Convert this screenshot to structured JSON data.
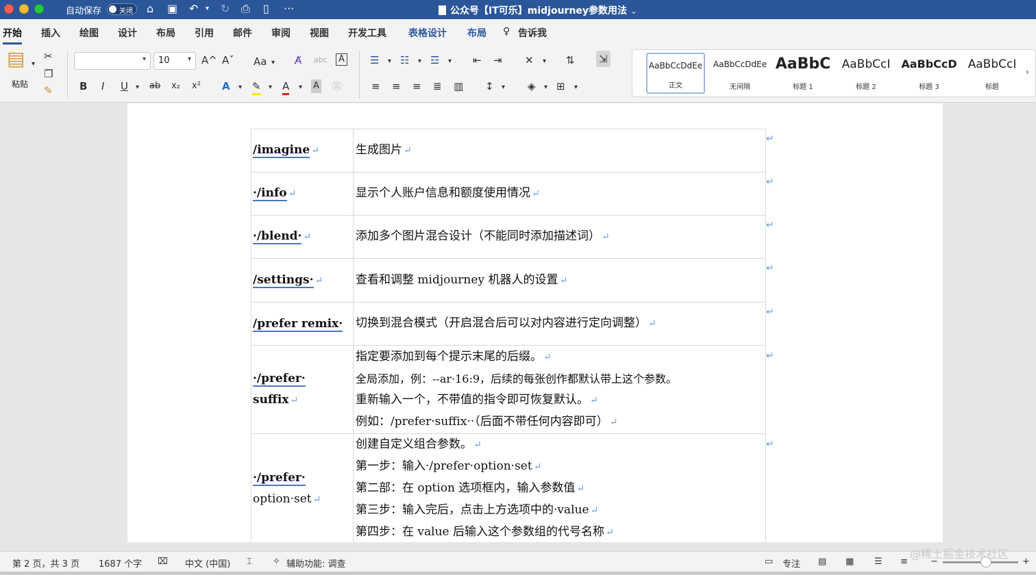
{
  "titlebar": {
    "autosave_label": "自动保存",
    "autosave_state": "关闭",
    "document_title": "公众号【IT可乐】midjourney参数用法",
    "title_chevron": "⌄"
  },
  "tabs": [
    "开始",
    "插入",
    "绘图",
    "设计",
    "布局",
    "引用",
    "邮件",
    "审阅",
    "视图",
    "开发工具",
    "表格设计",
    "布局",
    "告诉我"
  ],
  "ribbon": {
    "paste_label": "粘贴",
    "font_name": "",
    "font_size": "10",
    "grow_font": "A^",
    "shrink_font": "Aˇ",
    "change_case": "Aa",
    "bold": "B",
    "italic": "I",
    "underline": "U",
    "strikethrough": "ab",
    "subscript": "x₂",
    "superscript": "x²",
    "styles": [
      {
        "sample": "AaBbCcDdEe",
        "name": "正文"
      },
      {
        "sample": "AaBbCcDdEe",
        "name": "无间隔"
      },
      {
        "sample": "AaBbC",
        "name": "标题 1"
      },
      {
        "sample": "AaBbCcI",
        "name": "标题 2"
      },
      {
        "sample": "AaBbCcD",
        "name": "标题 3"
      },
      {
        "sample": "AaBbCcI",
        "name": "标题"
      }
    ]
  },
  "table": {
    "rows": [
      {
        "cmd": "/imagine",
        "lines": [
          "生成图片"
        ]
      },
      {
        "cmd": "·/info",
        "lines": [
          "显示个人账户信息和额度使用情况"
        ]
      },
      {
        "cmd": "·/blend·",
        "lines": [
          "添加多个图片混合设计（不能同时添加描述词）"
        ]
      },
      {
        "cmd": "/settings·",
        "lines": [
          "查看和调整 midjourney 机器人的设置"
        ]
      },
      {
        "cmd": "/prefer remix·",
        "lines": [
          "切换到混合模式（开启混合后可以对内容进行定向调整）"
        ]
      },
      {
        "cmd_lines": [
          "·/prefer·",
          "suffix"
        ],
        "lines": [
          "指定要添加到每个提示末尾的后缀。",
          "全局添加，例：--ar·16:9，后续的每张创作都默认带上这个参数。",
          "重新输入一个，不带值的指令即可恢复默认。",
          "例如：/prefer·suffix··（后面不带任何内容即可）"
        ]
      },
      {
        "cmd_lines": [
          "·/prefer·",
          "option·set"
        ],
        "lines": [
          "创建自定义组合参数。",
          "第一步：输入·/prefer·option·set",
          "第二部：在 option 选项框内，输入参数值",
          "第三步：输入完后，点击上方选项中的·value",
          "第四步：在 value 后输入这个参数组的代号名称"
        ]
      }
    ],
    "paragraph_mark": "↵"
  },
  "status": {
    "page": "第 2 页，共 3 页",
    "words": "1687 个字",
    "language": "中文 (中国)",
    "accessibility": "辅助功能: 调查",
    "focus": "专注"
  },
  "watermark": "@稀土掘金技术社区"
}
